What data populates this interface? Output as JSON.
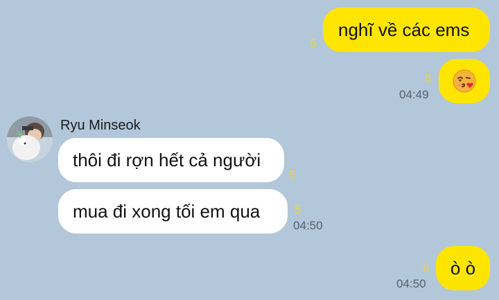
{
  "conversation": {
    "messages": [
      {
        "sender": "me",
        "text": "nghĩ về các ems",
        "unread": "5"
      },
      {
        "sender": "me",
        "emoji": "kissing-face-with-heart",
        "unread": "5",
        "time": "04:49"
      },
      {
        "sender": "Ryu Minseok",
        "text": "thôi đi rợn hết cả người",
        "unread": "5"
      },
      {
        "sender": "Ryu Minseok",
        "text": "mua đi xong tối em qua",
        "unread": "5",
        "time": "04:50"
      },
      {
        "sender": "me",
        "text": "ò ò",
        "unread": "6",
        "time": "04:50"
      }
    ],
    "contact_name": "Ryu Minseok"
  },
  "colors": {
    "background": "#b2c7d9",
    "my_bubble": "#fee500",
    "their_bubble": "#ffffff",
    "unread_count": "#e8d63c",
    "timestamp": "#55626e"
  }
}
